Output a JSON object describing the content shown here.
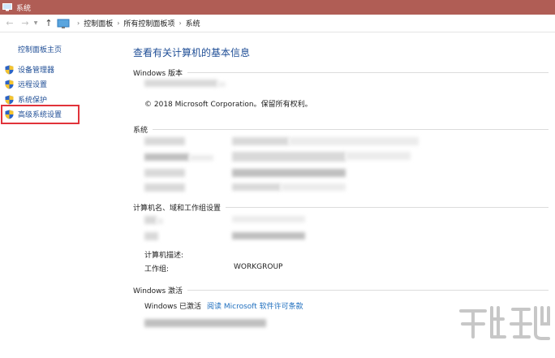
{
  "window": {
    "title": "系统"
  },
  "address": {
    "crumbs": [
      "控制面板",
      "所有控制面板项",
      "系统"
    ]
  },
  "sidebar": {
    "home": "控制面板主页",
    "items": [
      {
        "label": "设备管理器"
      },
      {
        "label": "远程设置"
      },
      {
        "label": "系统保护"
      },
      {
        "label": "高级系统设置"
      }
    ]
  },
  "main": {
    "title": "查看有关计算机的基本信息",
    "windows_edition": {
      "header": "Windows 版本",
      "copyright": "© 2018 Microsoft Corporation。保留所有权利。"
    },
    "system": {
      "header": "系统"
    },
    "computer": {
      "header": "计算机名、域和工作组设置",
      "desc_label": "计算机描述:",
      "workgroup_label": "工作组:",
      "workgroup_value": "WORKGROUP"
    },
    "activation": {
      "header": "Windows 激活",
      "status": "Windows 已激活",
      "license_link": "阅读 Microsoft 软件许可条款"
    }
  },
  "colors": {
    "titlebar": "#b05d55",
    "link": "#1f4e96",
    "highlight": "#e1333a"
  }
}
